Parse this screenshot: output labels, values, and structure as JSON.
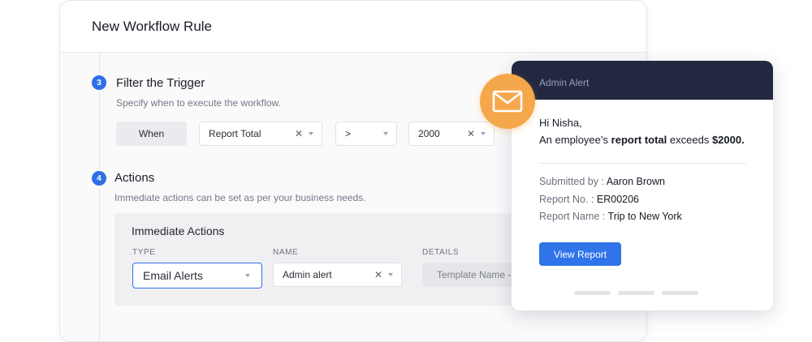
{
  "card": {
    "title": "New Workflow Rule"
  },
  "steps": [
    {
      "number": "3",
      "title": "Filter the Trigger",
      "description": "Specify when to execute the workflow."
    },
    {
      "number": "4",
      "title": "Actions",
      "description": "Immediate actions can be set as per your business needs."
    }
  ],
  "trigger": {
    "when_label": "When",
    "field": "Report Total",
    "operator": ">",
    "value": "2000"
  },
  "actions_panel": {
    "title": "Immediate Actions",
    "columns": {
      "type": "TYPE",
      "name": "NAME",
      "details": "DETAILS"
    },
    "type_value": "Email Alerts",
    "name_value": "Admin alert",
    "details_placeholder": "Template Name - D"
  },
  "alert": {
    "header": "Admin Alert",
    "greeting": "Hi Nisha,",
    "message_prefix": "An employee’s ",
    "message_bold1": "report total",
    "message_middle": " exceeds ",
    "message_bold2": "$2000.",
    "rows": [
      {
        "label": "Submitted by : ",
        "value": "Aaron Brown"
      },
      {
        "label": "Report No. : ",
        "value": "ER00206"
      },
      {
        "label": "Report Name : ",
        "value": "Trip to New York"
      }
    ],
    "button_label": "View Report"
  },
  "icons": {
    "mail": "envelope-icon",
    "clear": "x-icon",
    "dropdown": "chevron-down-icon"
  },
  "colors": {
    "accent": "#2f74e8",
    "mail_badge": "#f5a84b",
    "alert_header": "#222840"
  }
}
